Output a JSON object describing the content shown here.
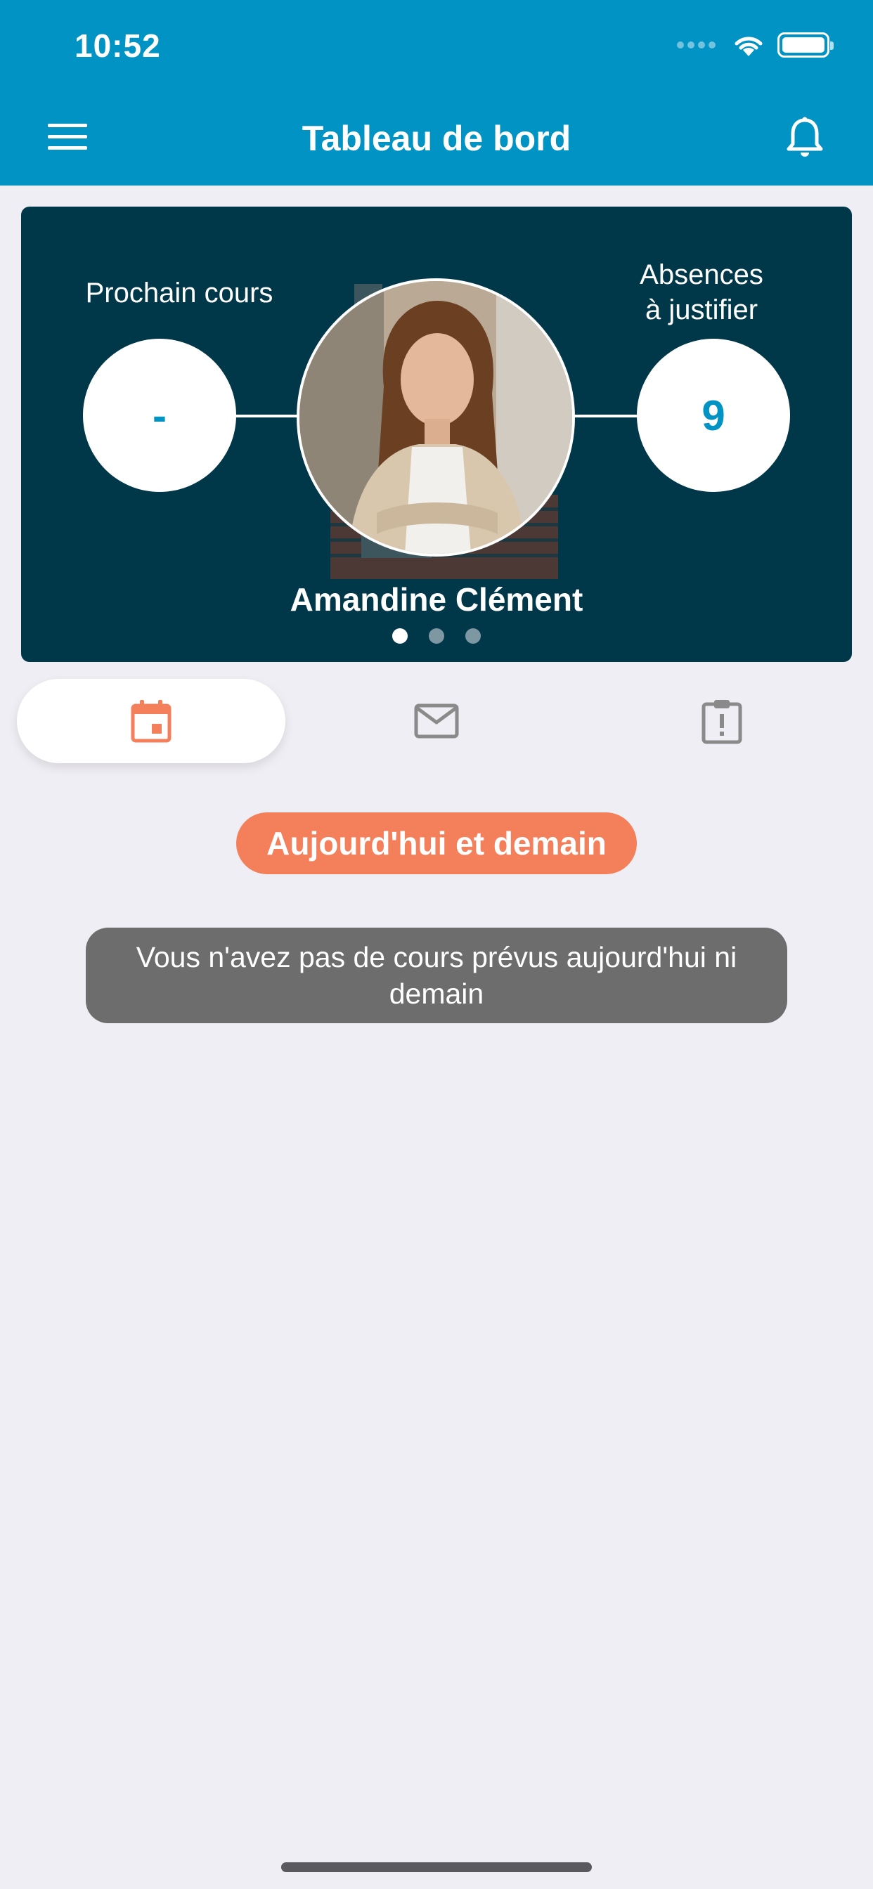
{
  "status_bar": {
    "time": "10:52"
  },
  "header": {
    "title": "Tableau de bord",
    "menu_icon": "hamburger-menu-icon",
    "bell_icon": "bell-icon"
  },
  "profile_card": {
    "next_course_label": "Prochain cours",
    "next_course_value": "-",
    "absences_label_line1": "Absences",
    "absences_label_line2": "à justifier",
    "absences_value": "9",
    "name": "Amandine Clément",
    "pager": {
      "total": 3,
      "active": 1
    }
  },
  "tabs": [
    {
      "id": "agenda",
      "icon": "calendar-icon",
      "active": true
    },
    {
      "id": "messages",
      "icon": "mail-icon",
      "active": false
    },
    {
      "id": "absences",
      "icon": "clipboard-alert-icon",
      "active": false
    }
  ],
  "content": {
    "section_label": "Aujourd'hui et demain",
    "empty_message": "Vous n'avez pas de cours prévus aujourd'hui ni demain"
  },
  "colors": {
    "primary": "#0093c4",
    "card_bg": "#00384a",
    "accent": "#f47f5b",
    "page_bg": "#efeef4",
    "empty_box": "#6d6d6d"
  }
}
